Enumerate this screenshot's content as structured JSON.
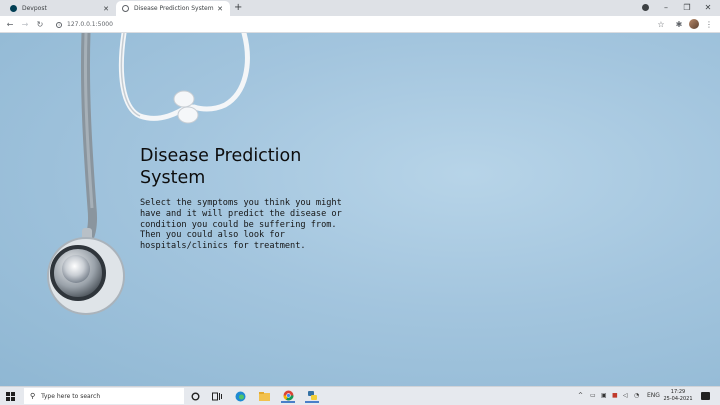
{
  "browser": {
    "tabs": [
      {
        "title": "Devpost",
        "favicon": "devpost-icon",
        "active": false
      },
      {
        "title": "Disease Prediction System",
        "favicon": "globe-icon",
        "active": true
      }
    ],
    "new_tab_label": "+",
    "address": "127.0.0.1:5000",
    "window_controls": {
      "minimize": "–",
      "restore": "❐",
      "close": "✕"
    }
  },
  "page": {
    "title": "Disease Prediction System",
    "description": "Select the symptoms you think you might have and it will predict the disease or condition you could be suffering from.\nThen you could also look for hospitals/clinics for treatment.",
    "background_color": "#a8c9e0"
  },
  "taskbar": {
    "search_placeholder": "Type here to search",
    "language": "ENG",
    "time": "17:29",
    "date": "25-04-2021"
  }
}
